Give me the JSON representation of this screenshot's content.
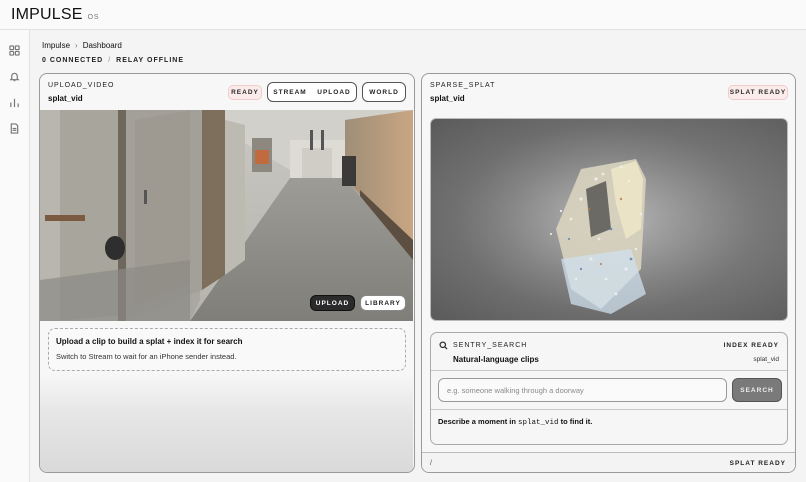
{
  "app": {
    "brand": "IMPULSE",
    "brand_sub": "OS"
  },
  "sidebar": {
    "items": [
      {
        "icon": "grid-icon"
      },
      {
        "icon": "bell-icon"
      },
      {
        "icon": "bar-chart-icon"
      },
      {
        "icon": "document-icon"
      }
    ]
  },
  "breadcrumb": {
    "root": "Impulse",
    "current": "Dashboard"
  },
  "status": {
    "connected": "0 CONNECTED",
    "separator": "/",
    "relay": "RELAY OFFLINE"
  },
  "upload_panel": {
    "kicker": "UPLOAD_VIDEO",
    "title": "splat_vid",
    "status_pill": "READY",
    "mode_stream": "STREAM",
    "mode_upload": "UPLOAD",
    "world_label": "WORLD",
    "video_upload_label": "UPLOAD",
    "video_library_label": "LIBRARY",
    "dropzone_title": "Upload a clip to build a splat + index it for search",
    "dropzone_sub": "Switch to Stream to wait for an iPhone sender instead."
  },
  "splat_panel": {
    "kicker": "SPARSE_SPLAT",
    "title": "splat_vid",
    "status_pill": "SPLAT READY",
    "search": {
      "kicker": "SENTRY_SEARCH",
      "index_status": "INDEX READY",
      "title": "Natural-language clips",
      "video_name": "splat_vid",
      "placeholder": "e.g. someone walking through a doorway",
      "button": "SEARCH",
      "help_prefix": "Describe a moment in ",
      "help_code": "splat_vid",
      "help_suffix": " to find it."
    },
    "footer_left": "/",
    "footer_right": "SPLAT READY"
  },
  "colors": {
    "accent_pill": "#fbecec",
    "primary_dark": "#2b2b2b",
    "border": "#9a9a9a"
  }
}
